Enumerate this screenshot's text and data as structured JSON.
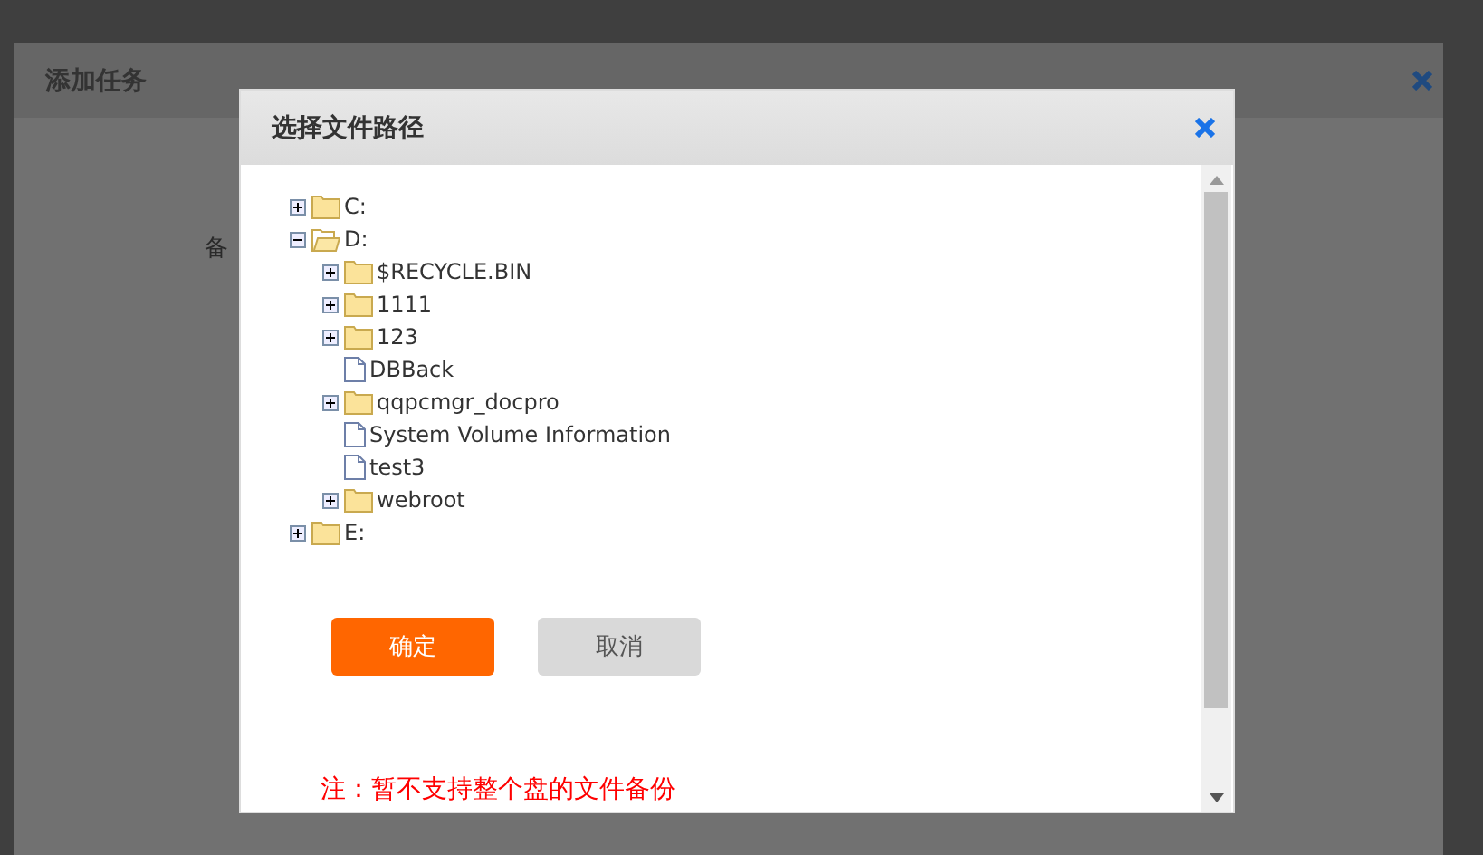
{
  "background_dialog": {
    "title": "添加任务",
    "labels": [
      "备"
    ]
  },
  "dialog": {
    "title": "选择文件路径",
    "tree": [
      {
        "label": "C:",
        "kind": "folder",
        "expanded": false
      },
      {
        "label": "D:",
        "kind": "folder",
        "expanded": true,
        "children": [
          {
            "label": "$RECYCLE.BIN",
            "kind": "folder",
            "expanded": false
          },
          {
            "label": "1111",
            "kind": "folder",
            "expanded": false
          },
          {
            "label": "123",
            "kind": "folder",
            "expanded": false
          },
          {
            "label": "DBBack",
            "kind": "file"
          },
          {
            "label": "qqpcmgr_docpro",
            "kind": "folder",
            "expanded": false
          },
          {
            "label": "System Volume Information",
            "kind": "file"
          },
          {
            "label": "test3",
            "kind": "file"
          },
          {
            "label": "webroot",
            "kind": "folder",
            "expanded": false
          }
        ]
      },
      {
        "label": "E:",
        "kind": "folder",
        "expanded": false
      }
    ],
    "buttons": [
      {
        "label": "确定",
        "kind": "primary"
      },
      {
        "label": "取消",
        "kind": "secondary"
      }
    ],
    "note": "注：暂不支持整个盘的文件备份"
  }
}
